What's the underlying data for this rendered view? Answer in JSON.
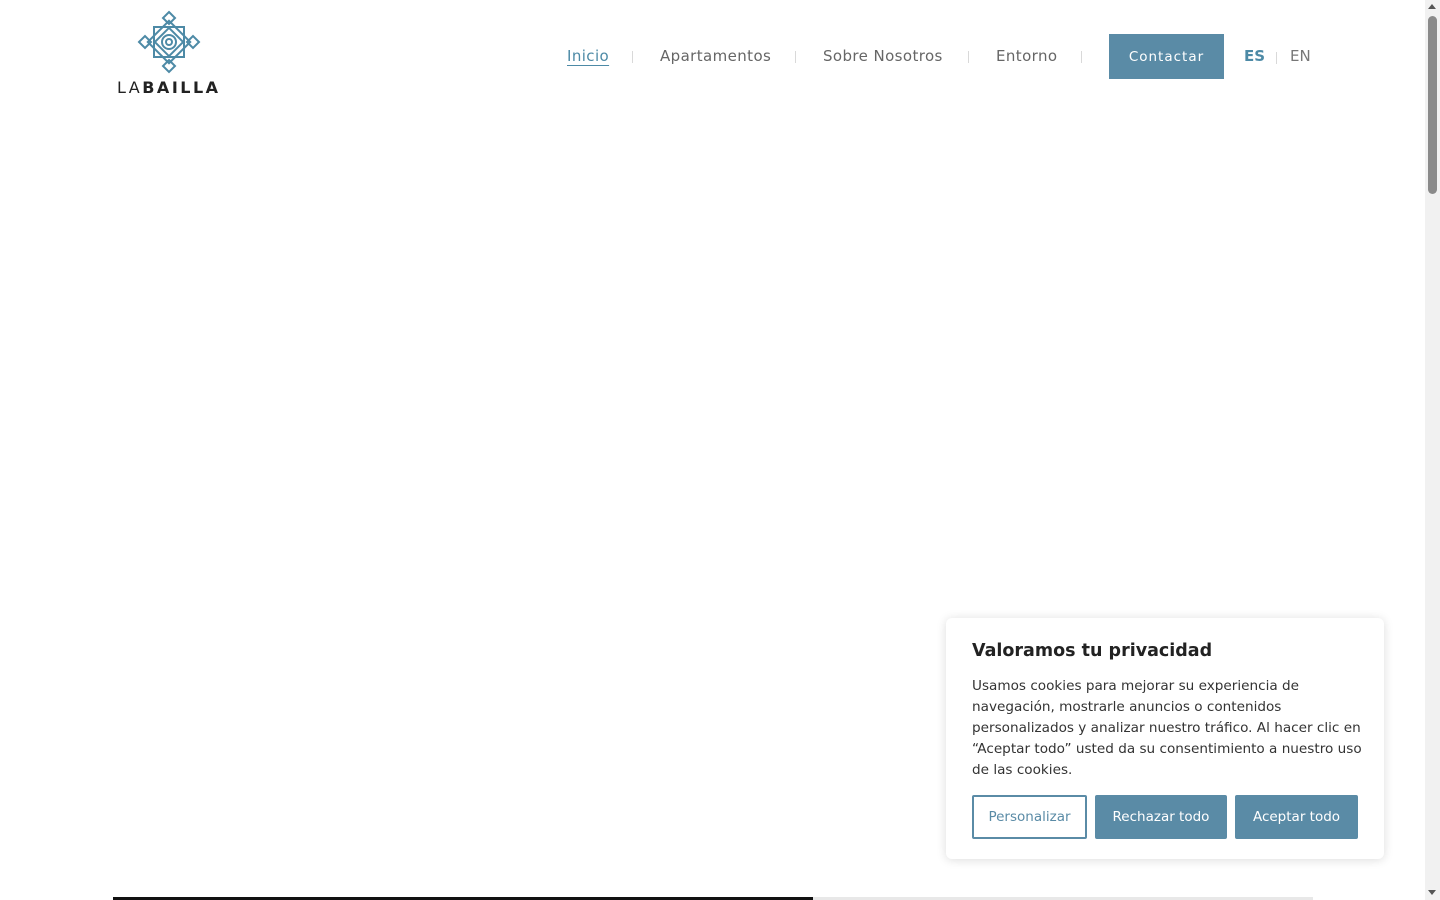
{
  "brand": {
    "name_light": "LA",
    "name_bold": "BAILLA",
    "accent_color": "#5a8ba6"
  },
  "nav": {
    "items": [
      {
        "label": "Inicio",
        "active": true
      },
      {
        "label": "Apartamentos",
        "active": false
      },
      {
        "label": "Sobre Nosotros",
        "active": false
      },
      {
        "label": "Entorno",
        "active": false
      }
    ],
    "contact_label": "Contactar",
    "languages": [
      {
        "code": "ES",
        "active": true
      },
      {
        "code": "EN",
        "active": false
      }
    ]
  },
  "slider": {
    "progress": 0.583
  },
  "cookie_banner": {
    "title": "Valoramos tu privacidad",
    "body": "Usamos cookies para mejorar su experiencia de navegación, mostrarle anuncios o contenidos personalizados y analizar nuestro tráfico. Al hacer clic en “Aceptar todo” usted da su consentimiento a nuestro uso de las cookies.",
    "customize_label": "Personalizar",
    "reject_label": "Rechazar todo",
    "accept_label": "Aceptar todo"
  }
}
